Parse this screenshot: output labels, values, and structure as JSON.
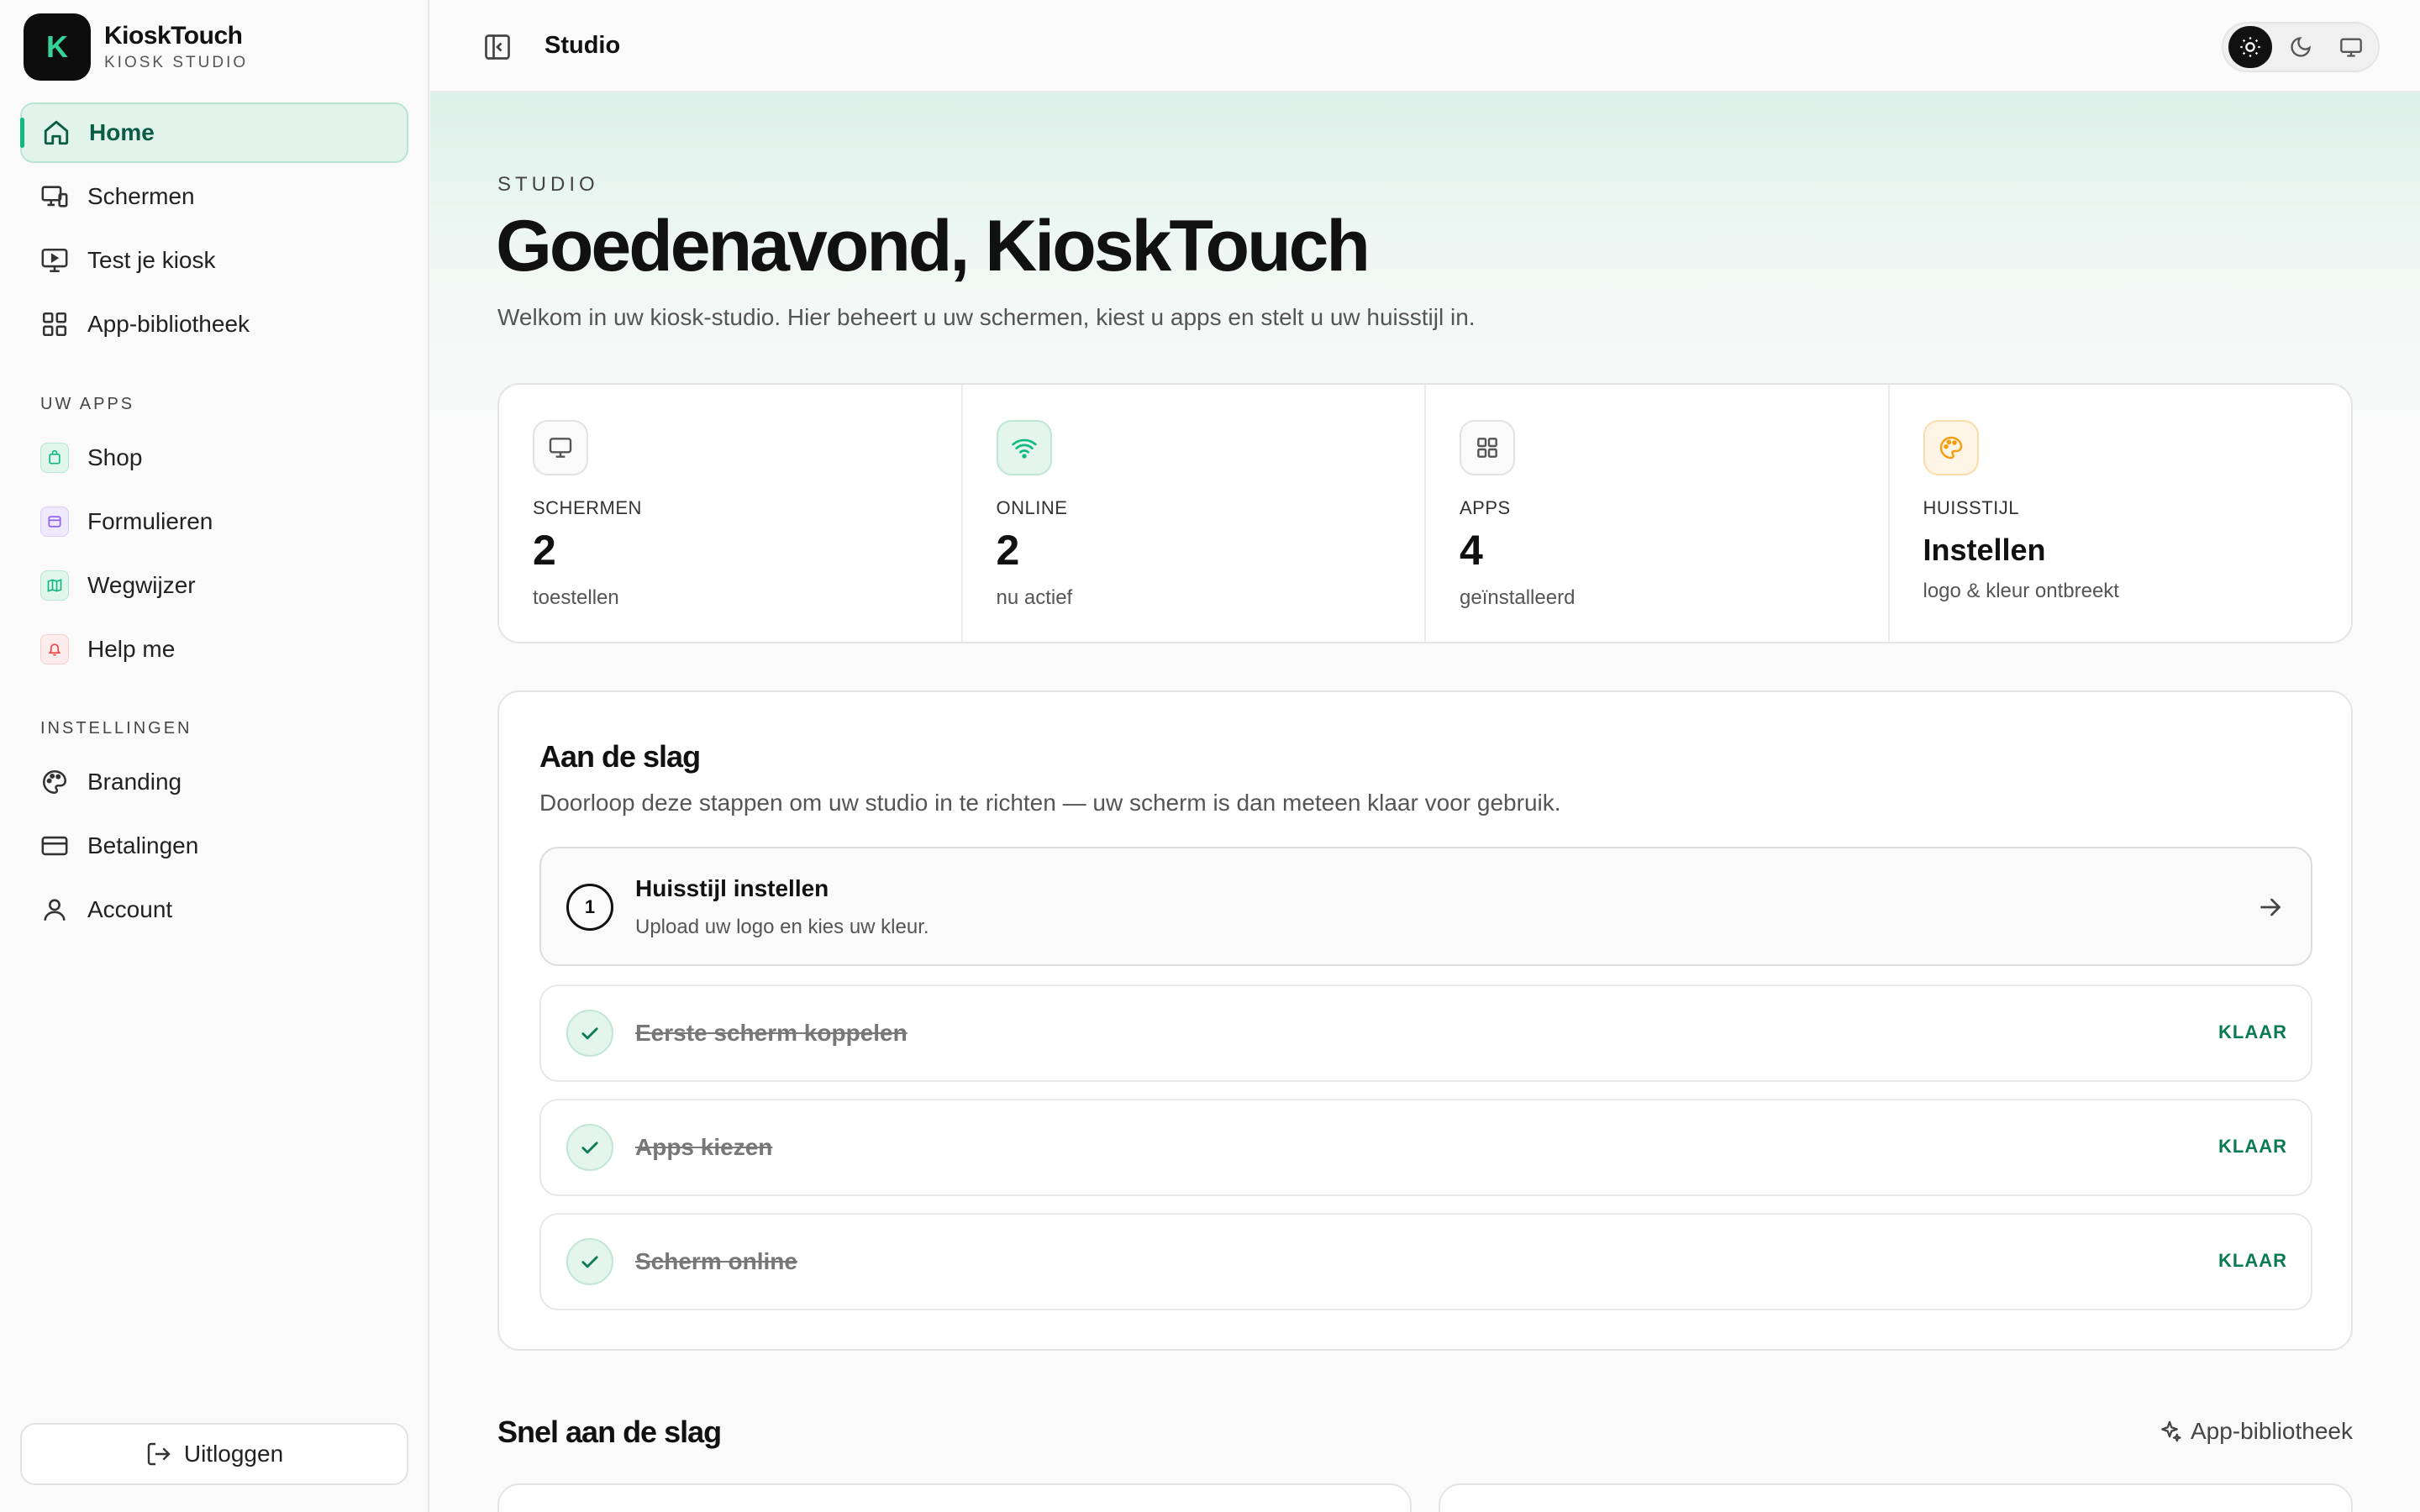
{
  "brand": {
    "logo_letter": "K",
    "name": "KioskTouch",
    "subtitle": "KIOSK STUDIO"
  },
  "sidebar": {
    "main_items": [
      {
        "label": "Home",
        "icon": "home-icon",
        "active": true
      },
      {
        "label": "Schermen",
        "icon": "devices-icon"
      },
      {
        "label": "Test je kiosk",
        "icon": "monitor-play-icon"
      },
      {
        "label": "App-bibliotheek",
        "icon": "grid-icon"
      }
    ],
    "apps_label": "UW APPS",
    "apps": [
      {
        "label": "Shop",
        "icon": "shop-icon",
        "color": "#10b981"
      },
      {
        "label": "Formulieren",
        "icon": "form-icon",
        "color": "#8b5cf6"
      },
      {
        "label": "Wegwijzer",
        "icon": "map-icon",
        "color": "#10b981"
      },
      {
        "label": "Help me",
        "icon": "bell-icon",
        "color": "#ef4444"
      }
    ],
    "settings_label": "INSTELLINGEN",
    "settings": [
      {
        "label": "Branding",
        "icon": "palette-icon"
      },
      {
        "label": "Betalingen",
        "icon": "credit-card-icon"
      },
      {
        "label": "Account",
        "icon": "user-icon"
      }
    ],
    "logout_label": "Uitloggen"
  },
  "topbar": {
    "title": "Studio",
    "theme_active": "light"
  },
  "hero": {
    "eyebrow": "STUDIO",
    "greeting": "Goedenavond, KioskTouch",
    "welcome": "Welkom in uw kiosk-studio. Hier beheert u uw schermen, kiest u apps en stelt u uw huisstijl in."
  },
  "stats": [
    {
      "label": "SCHERMEN",
      "value": "2",
      "sub": "toestellen",
      "icon": "monitor-icon"
    },
    {
      "label": "ONLINE",
      "value": "2",
      "sub": "nu actief",
      "icon": "wifi-icon"
    },
    {
      "label": "APPS",
      "value": "4",
      "sub": "geïnstalleerd",
      "icon": "grid-icon"
    },
    {
      "label": "HUISSTIJL",
      "value": "Instellen",
      "sub": "logo & kleur ontbreekt",
      "icon": "palette-icon"
    }
  ],
  "getting_started": {
    "title": "Aan de slag",
    "description": "Doorloop deze stappen om uw studio in te richten — uw scherm is dan meteen klaar voor gebruik.",
    "current_step": {
      "number": "1",
      "title": "Huisstijl instellen",
      "subtitle": "Upload uw logo en kies uw kleur."
    },
    "done_steps": [
      {
        "title": "Eerste scherm koppelen",
        "badge": "KLAAR"
      },
      {
        "title": "Apps kiezen",
        "badge": "KLAAR"
      },
      {
        "title": "Scherm online",
        "badge": "KLAAR"
      }
    ]
  },
  "quick_start": {
    "title": "Snel aan de slag",
    "link_label": "App-bibliotheek"
  },
  "colors": {
    "accent": "#10b981",
    "accent_dark": "#0a7a55",
    "active_bg": "#e2f3ec",
    "warning": "#f59e0b"
  }
}
